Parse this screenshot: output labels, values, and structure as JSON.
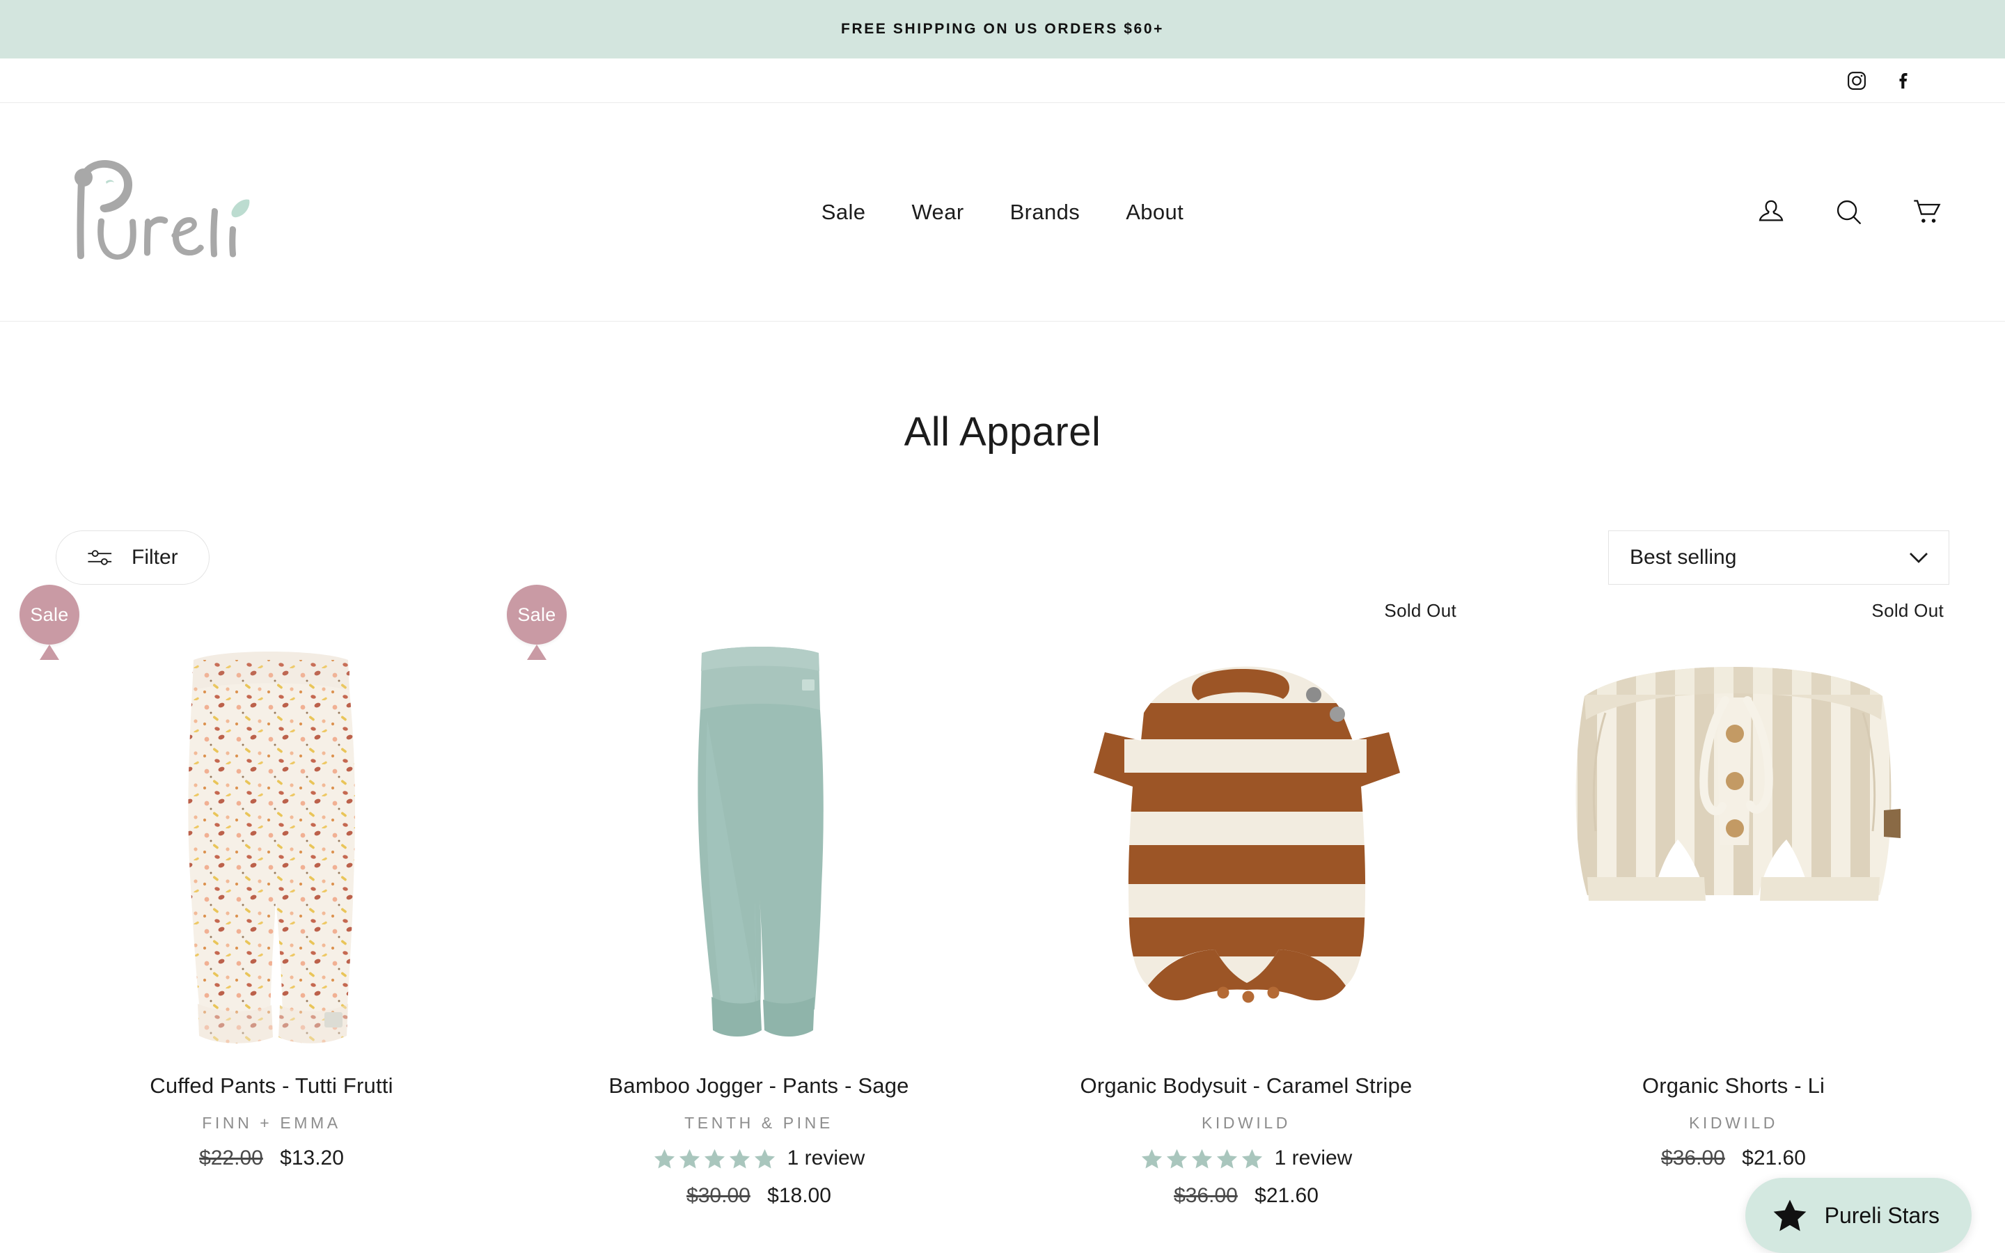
{
  "announcement": {
    "text": "FREE SHIPPING ON US ORDERS $60+"
  },
  "social": [
    {
      "name": "instagram-icon",
      "label": "Instagram"
    },
    {
      "name": "facebook-icon",
      "label": "Facebook"
    }
  ],
  "header": {
    "logo_text": "Pureli",
    "nav": [
      {
        "label": "Sale"
      },
      {
        "label": "Wear"
      },
      {
        "label": "Brands"
      },
      {
        "label": "About"
      }
    ],
    "icons": [
      {
        "name": "account-icon",
        "label": "Log in"
      },
      {
        "name": "search-icon",
        "label": "Search"
      },
      {
        "name": "cart-icon",
        "label": "Cart"
      }
    ]
  },
  "collection": {
    "title": "All Apparel",
    "filter_label": "Filter",
    "sort_value": "Best selling",
    "sort_options": [
      "Best selling"
    ]
  },
  "products": [
    {
      "title": "Cuffed Pants - Tutti Frutti",
      "vendor": "FINN + EMMA",
      "badge": "Sale",
      "sold_out": "",
      "reviews": null,
      "rating": 0,
      "price_old": "$22.00",
      "price_new": "$13.20",
      "image": "cuffed-pants-tutti-frutti"
    },
    {
      "title": "Bamboo Jogger - Pants - Sage",
      "vendor": "TENTH & PINE",
      "badge": "Sale",
      "sold_out": "",
      "reviews": "1 review",
      "rating": 5,
      "price_old": "$30.00",
      "price_new": "$18.00",
      "image": "bamboo-jogger-pants-sage"
    },
    {
      "title": "Organic Bodysuit - Caramel Stripe",
      "vendor": "KIDWILD",
      "badge": "",
      "sold_out": "Sold Out",
      "reviews": "1 review",
      "rating": 5,
      "price_old": "$36.00",
      "price_new": "$21.60",
      "image": "organic-bodysuit-caramel-stripe"
    },
    {
      "title": "Organic Shorts - Li",
      "vendor": "KIDWILD",
      "badge": "",
      "sold_out": "Sold Out",
      "reviews": null,
      "rating": 0,
      "price_old": "$36.00",
      "price_new": "$21.60",
      "image": "organic-shorts-linen-stripe"
    }
  ],
  "rewards_widget": {
    "label": "Pureli Stars"
  },
  "colors": {
    "announcement_bg": "#d3e5de",
    "sale_badge": "#c99aa4",
    "star": "#a9c6bd",
    "rewards_bg": "#d3e8e0",
    "logo": "#a8a8a8",
    "logo_leaf": "#bcdcd0"
  }
}
